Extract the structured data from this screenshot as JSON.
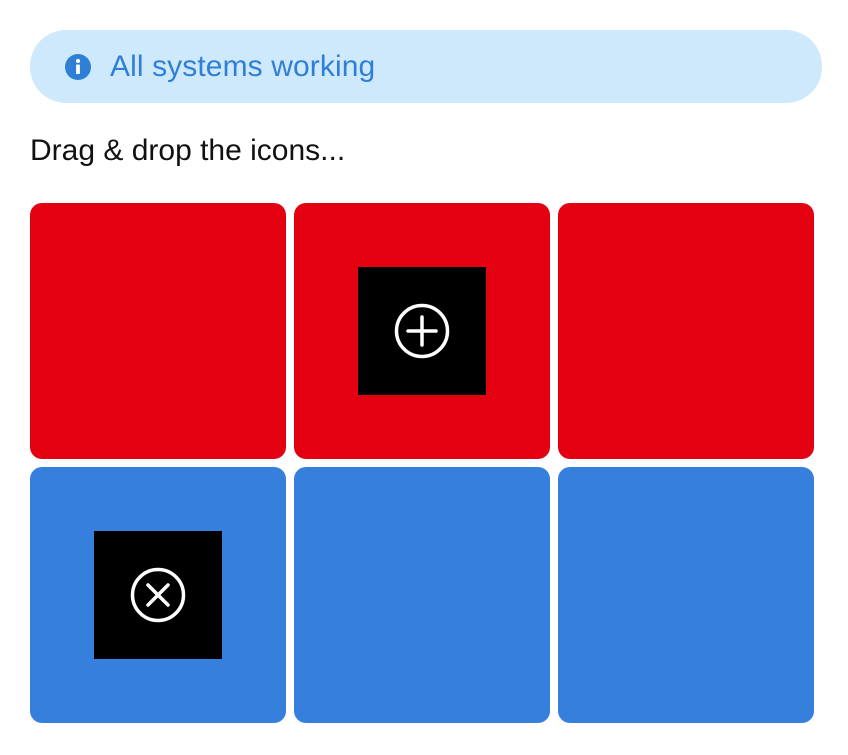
{
  "status_banner": {
    "icon": "info-icon",
    "text": "All systems working",
    "background_color": "#cfe9fc",
    "text_color": "#2f7fd6"
  },
  "instructions": "Drag & drop the icons...",
  "grid": {
    "rows": [
      {
        "color": "#e30011",
        "cells": [
          {
            "icon": null
          },
          {
            "icon": "plus-circle-icon"
          },
          {
            "icon": null
          }
        ]
      },
      {
        "color": "#377fdc",
        "cells": [
          {
            "icon": "x-circle-icon"
          },
          {
            "icon": null
          },
          {
            "icon": null
          }
        ]
      }
    ],
    "tile_color": "#000000"
  }
}
